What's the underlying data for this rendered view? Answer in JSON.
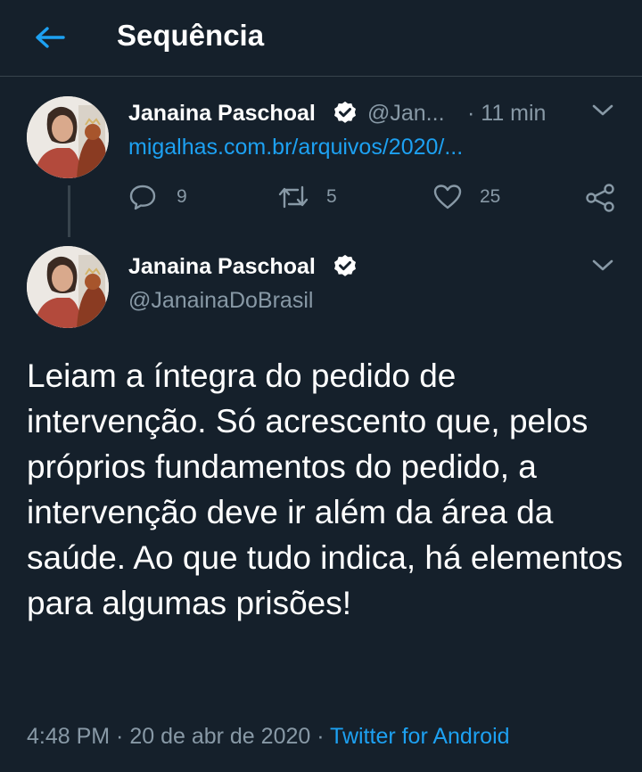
{
  "header": {
    "title": "Sequência"
  },
  "tweet1": {
    "name": "Janaina Paschoal",
    "handle": "@Jan...",
    "time": "· 11 min",
    "link": "migalhas.com.br/arquivos/2020/...",
    "replies": "9",
    "retweets": "5",
    "likes": "25"
  },
  "tweet2": {
    "name": "Janaina Paschoal",
    "handle": "@JanainaDoBrasil",
    "text": "Leiam a íntegra do pedido de intervenção. Só acrescento que, pelos próprios fundamentos do pedido, a intervenção deve ir além da área da saúde. Ao que tudo indica, há elementos para algumas prisões!",
    "timestamp": "4:48 PM · 20 de abr de 2020 · ",
    "source": "Twitter for Android"
  },
  "colors": {
    "background": "#15202b",
    "accent": "#1da1f2",
    "muted": "#8899a6",
    "divider": "#38444d"
  },
  "icons": {
    "back": "arrow-left-icon",
    "verified": "verified-badge-icon",
    "menu": "chevron-down-icon",
    "reply": "reply-icon",
    "retweet": "retweet-icon",
    "like": "heart-icon",
    "share": "share-icon"
  }
}
